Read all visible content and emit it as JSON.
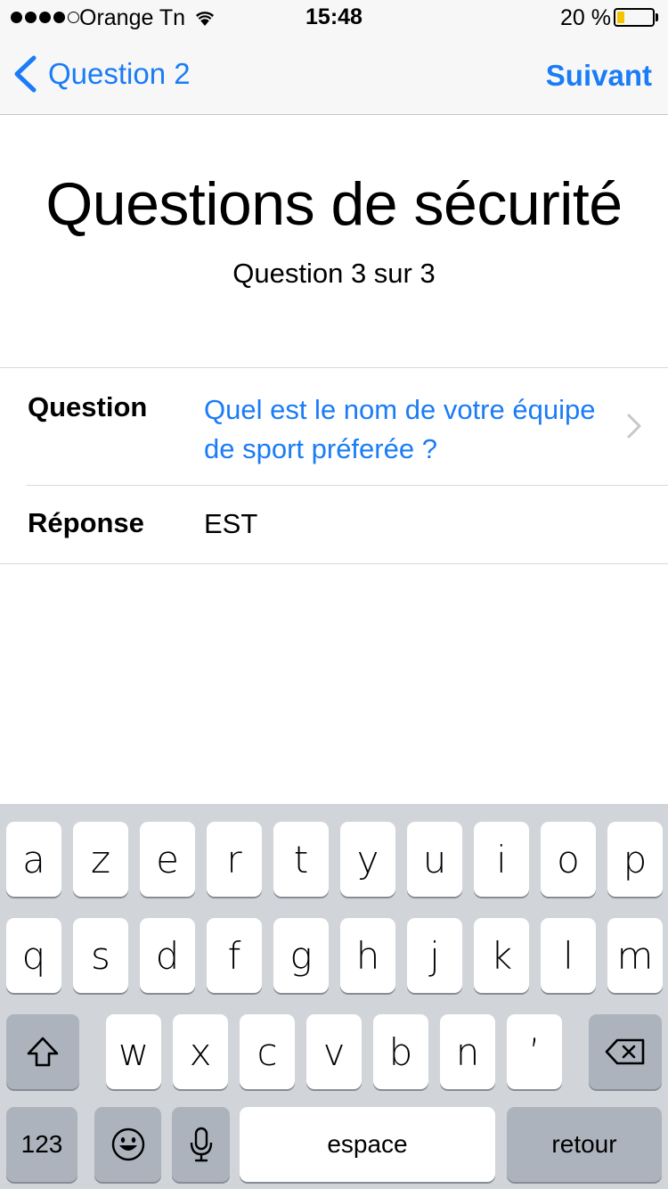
{
  "status_bar": {
    "carrier": "Orange Tn",
    "time": "15:48",
    "battery_percent": "20 %",
    "battery_level": 0.2,
    "signal_bars": 4,
    "signal_max": 5
  },
  "nav": {
    "back_label": "Question 2",
    "next_label": "Suivant",
    "accent_color": "#1a7cf6"
  },
  "header": {
    "title": "Questions de sécurité",
    "subtitle": "Question 3 sur 3"
  },
  "form": {
    "question_label": "Question",
    "question_value": "Quel est le nom de votre équipe de sport préferée ?",
    "answer_label": "Réponse",
    "answer_value": "EST"
  },
  "keyboard": {
    "row1": [
      "a",
      "z",
      "e",
      "r",
      "t",
      "y",
      "u",
      "i",
      "o",
      "p"
    ],
    "row2": [
      "q",
      "s",
      "d",
      "f",
      "g",
      "h",
      "j",
      "k",
      "l",
      "m"
    ],
    "row3": [
      "w",
      "x",
      "c",
      "v",
      "b",
      "n",
      "’"
    ],
    "numbers_label": "123",
    "space_label": "espace",
    "return_label": "retour"
  },
  "icons": [
    "chevron-left-icon",
    "wifi-icon",
    "battery-icon",
    "chevron-right-icon",
    "shift-icon",
    "backspace-icon",
    "emoji-icon",
    "microphone-icon"
  ]
}
